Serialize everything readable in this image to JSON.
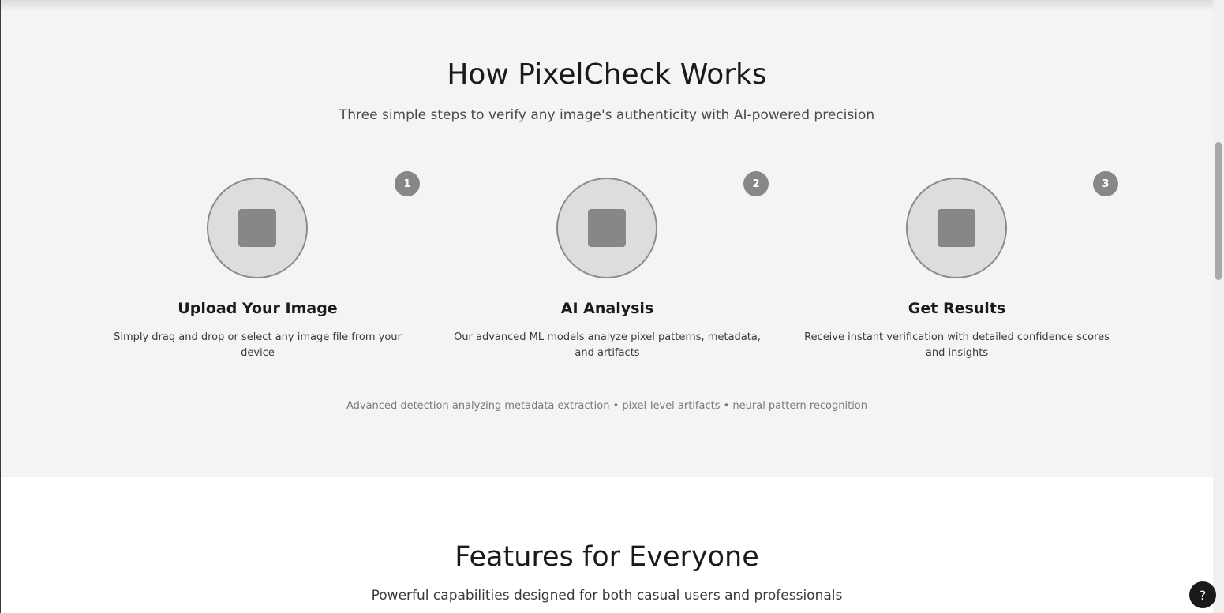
{
  "how_it_works": {
    "title": "How PixelCheck Works",
    "subtitle": "Three simple steps to verify any image's authenticity with AI-powered precision",
    "steps": [
      {
        "number": "1",
        "title": "Upload Your Image",
        "description": "Simply drag and drop or select any image file from your device",
        "icon": "placeholder-square-icon"
      },
      {
        "number": "2",
        "title": "AI Analysis",
        "description": "Our advanced ML models analyze pixel patterns, metadata, and artifacts",
        "icon": "placeholder-square-icon"
      },
      {
        "number": "3",
        "title": "Get Results",
        "description": "Receive instant verification with detailed confidence scores and insights",
        "icon": "placeholder-square-icon"
      }
    ],
    "detection_note": "Advanced detection analyzing metadata extraction • pixel-level artifacts • neural pattern recognition"
  },
  "features": {
    "title": "Features for Everyone",
    "subtitle": "Powerful capabilities designed for both casual users and professionals"
  },
  "help": {
    "label": "?"
  },
  "colors": {
    "section_bg": "#f4f4f4",
    "circle_fill": "#dddddd",
    "badge": "#878787",
    "help_button": "#1a1a1a"
  }
}
